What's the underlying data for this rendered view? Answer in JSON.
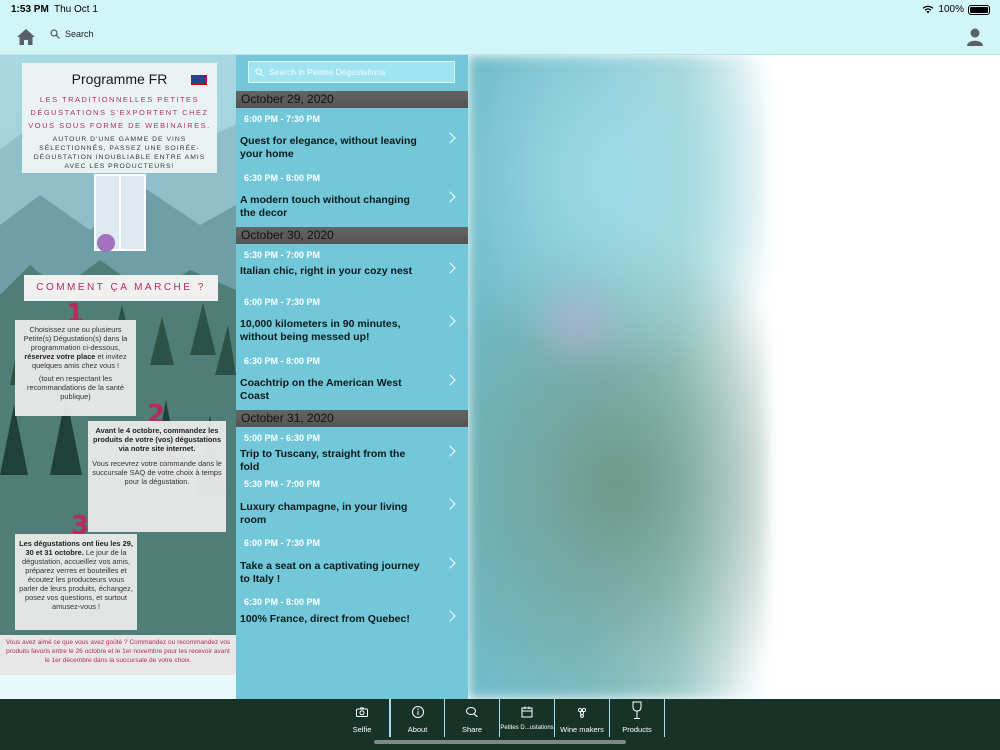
{
  "status_bar": {
    "time": "1:53 PM",
    "date": "Thu Oct 1",
    "battery": "100%"
  },
  "nav": {
    "search_label": "Search",
    "icons": [
      "home-icon",
      "search-icon",
      "user-icon"
    ]
  },
  "poster": {
    "title": "Programme FR",
    "subtitle": "LES TRADITIONNELLES PETITES DÉGUSTATIONS S'EXPORTENT CHEZ VOUS SOUS FORME DE WEBINAIRES.",
    "intro": "AUTOUR D'UNE GAMME DE VINS SÉLECTIONNÉS, PASSEZ UNE SOIRÉE-DÉGUSTATION INOUBLIABLE ENTRE AMIS AVEC LES PRODUCTEURS!",
    "how_it_works": "COMMENT ÇA MARCHE ?",
    "step1_num": "1",
    "step1_a": "Choisissez une ou plusieurs Petite(s) Dégustation(s) dans la programmation ci-dessous,",
    "step1_b": "réservez votre place",
    "step1_c": "et invitez quelques amis chez vous !",
    "step1_note": "(tout en respectant les recommandations de la santé publique)",
    "step2_num": "2",
    "step2_a": "Avant le 4 octobre, commandez les produits de votre (vos) dégustations via notre site internet.",
    "step2_b": "Vous recevrez votre commande dans le succursale SAQ de votre choix à temps pour la dégustation.",
    "step3_num": "3",
    "step3_a": "Les dégustations ont lieu les 29, 30 et 31 octobre.",
    "step3_b": "Le jour de la dégustation, accueillez vos amis, préparez verres et bouteilles et écoutez les producteurs vous parler de leurs produits, échangez, posez vos questions, et surtout amusez-vous !",
    "footer": "Vous avez aimé ce que vous avez goûté ? Commandez ou recommandez vos produits favoris entre le 26 octobre et le 1er novembre pour les recevoir avant le 1er décembre dans la succursale de votre choix."
  },
  "list": {
    "search_placeholder": "Search in Petites Dégustations",
    "days": [
      {
        "date": "October 29, 2020",
        "events": [
          {
            "time": "6:00 PM - 7:30 PM",
            "name": "Quest for elegance, without leaving your home"
          },
          {
            "time": "6:30 PM - 8:00 PM",
            "name": "A modern touch without changing the decor"
          }
        ]
      },
      {
        "date": "October 30, 2020",
        "events": [
          {
            "time": "5:30 PM - 7:00 PM",
            "name": "Italian chic, right in your cozy nest"
          },
          {
            "time": "6:00 PM - 7:30 PM",
            "name": "10,000 kilometers in 90 minutes, without being messed up!"
          },
          {
            "time": "6:30 PM - 8:00 PM",
            "name": "Coachtrip on the American West Coast"
          }
        ]
      },
      {
        "date": "October 31, 2020",
        "events": [
          {
            "time": "5:00 PM - 6:30 PM",
            "name": "Trip to Tuscany, straight from the fold"
          },
          {
            "time": "5:30 PM - 7:00 PM",
            "name": "Luxury champagne, in your living room"
          },
          {
            "time": "6:00 PM - 7:30 PM",
            "name": "Take a seat on a captivating journey to Italy !"
          },
          {
            "time": "6:30 PM - 8:00 PM",
            "name": "100% France, direct from Quebec!"
          }
        ]
      }
    ]
  },
  "tabs": [
    {
      "label": "Selfie",
      "icon": "camera-icon"
    },
    {
      "label": "About",
      "icon": "info-icon"
    },
    {
      "label": "Share",
      "icon": "chat-icon"
    },
    {
      "label": "Petites D...ustations",
      "icon": "calendar-icon"
    },
    {
      "label": "Wine makers",
      "icon": "grape-icon"
    },
    {
      "label": "Products",
      "icon": "wine-glass-icon"
    }
  ],
  "colors": {
    "accent": "#b72b5d",
    "list_bg": "#72c7d9",
    "tabbar_bg": "#173328",
    "header_bg": "#d2f6f8"
  }
}
